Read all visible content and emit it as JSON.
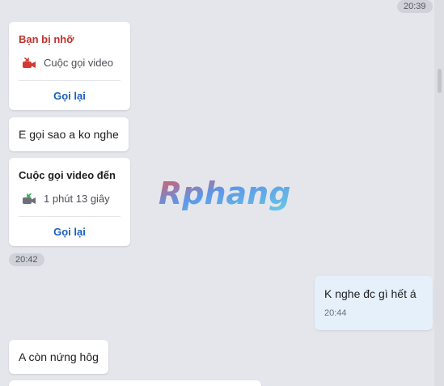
{
  "time_markers": [
    "20:39",
    "20:42"
  ],
  "missed_call": {
    "title": "Bạn bị nhỡ",
    "type_label": "Cuộc gọi video",
    "icon": "missed-video-call-icon",
    "action_label": "Gọi lại"
  },
  "message_1": "E gọi sao a ko nghe",
  "incoming_call": {
    "title": "Cuộc gọi video đến",
    "duration": "1 phút 13 giây",
    "icon": "incoming-video-call-icon",
    "action_label": "Gọi lại"
  },
  "sent_message": {
    "text": "K nghe đc gì hết á",
    "time": "20:44"
  },
  "message_2": "A còn nứng hôg",
  "watermark": "Rphang",
  "colors": {
    "missed_red": "#c1312c",
    "link_blue": "#1b5fc1",
    "sent_bubble": "#e6f0fb",
    "background": "#e4e6eb"
  }
}
